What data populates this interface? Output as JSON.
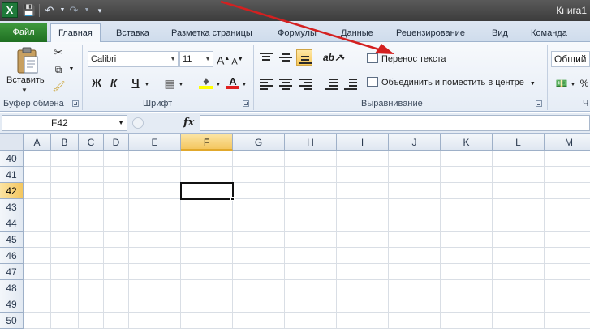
{
  "window": {
    "app_icon_letter": "X",
    "title": "Книга1"
  },
  "tabs": [
    {
      "label": "Файл"
    },
    {
      "label": "Главная"
    },
    {
      "label": "Вставка"
    },
    {
      "label": "Разметка страницы"
    },
    {
      "label": "Формулы"
    },
    {
      "label": "Данные"
    },
    {
      "label": "Рецензирование"
    },
    {
      "label": "Вид"
    },
    {
      "label": "Команда"
    }
  ],
  "ribbon": {
    "clipboard": {
      "paste_label": "Вставить",
      "group_label": "Буфер обмена"
    },
    "font": {
      "font_name": "Calibri",
      "font_size": "11",
      "bold": "Ж",
      "italic": "К",
      "underline": "Ч",
      "font_color_letter": "А",
      "grow": "A",
      "shrink": "A",
      "group_label": "Шрифт"
    },
    "alignment": {
      "wrap_text": "Перенос текста",
      "merge_center": "Объединить и поместить в центре",
      "group_label": "Выравнивание"
    },
    "number": {
      "format": "Общий",
      "percent": "%",
      "group_label": "Ч"
    }
  },
  "formula_bar": {
    "name_box": "F42",
    "fx": "fx",
    "formula": ""
  },
  "grid": {
    "columns": [
      "A",
      "B",
      "C",
      "D",
      "E",
      "F",
      "G",
      "H",
      "I",
      "J",
      "K",
      "L",
      "M"
    ],
    "rows": [
      "40",
      "41",
      "42",
      "43",
      "44",
      "45",
      "46",
      "47",
      "48",
      "49",
      "50"
    ],
    "active_column": "F",
    "active_row": "42"
  },
  "colors": {
    "file_tab": "#2a7f2e",
    "selection_header": "#f4c65f",
    "annotation_arrow": "#d42020"
  }
}
